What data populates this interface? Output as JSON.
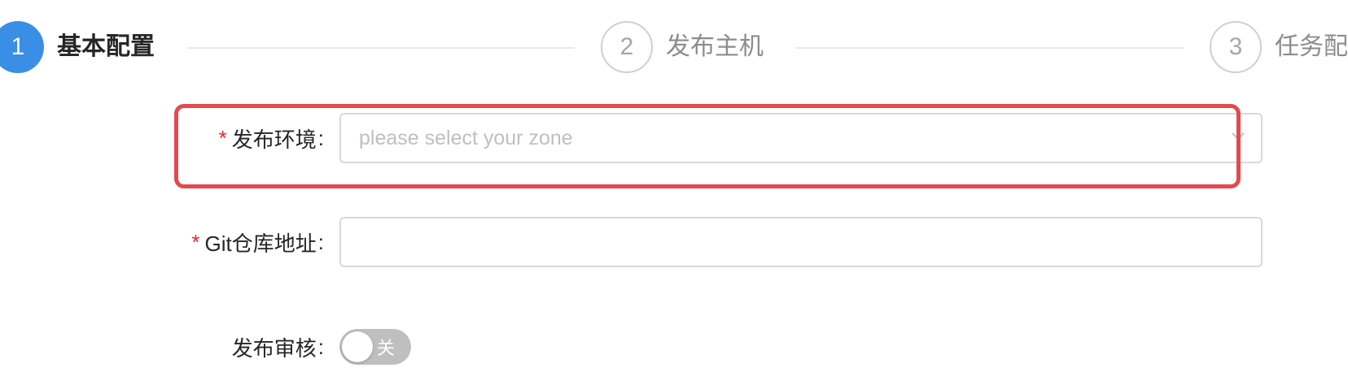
{
  "steps": [
    {
      "number": "1",
      "title": "基本配置",
      "state": "active"
    },
    {
      "number": "2",
      "title": "发布主机",
      "state": "inactive"
    },
    {
      "number": "3",
      "title": "任务配",
      "state": "inactive"
    }
  ],
  "form": {
    "env": {
      "required_mark": "*",
      "label": "发布环境",
      "colon": ":",
      "placeholder": "please select your zone"
    },
    "git": {
      "required_mark": "*",
      "label": "Git仓库地址",
      "colon": ":",
      "value": ""
    },
    "review": {
      "label": "发布审核",
      "colon": ":",
      "switch_text": "关",
      "switch_on": false
    }
  },
  "colors": {
    "accent": "#3a8ee6",
    "required": "#f5222d",
    "highlight": "#e5484d",
    "switch_off": "#bfbfbf"
  }
}
